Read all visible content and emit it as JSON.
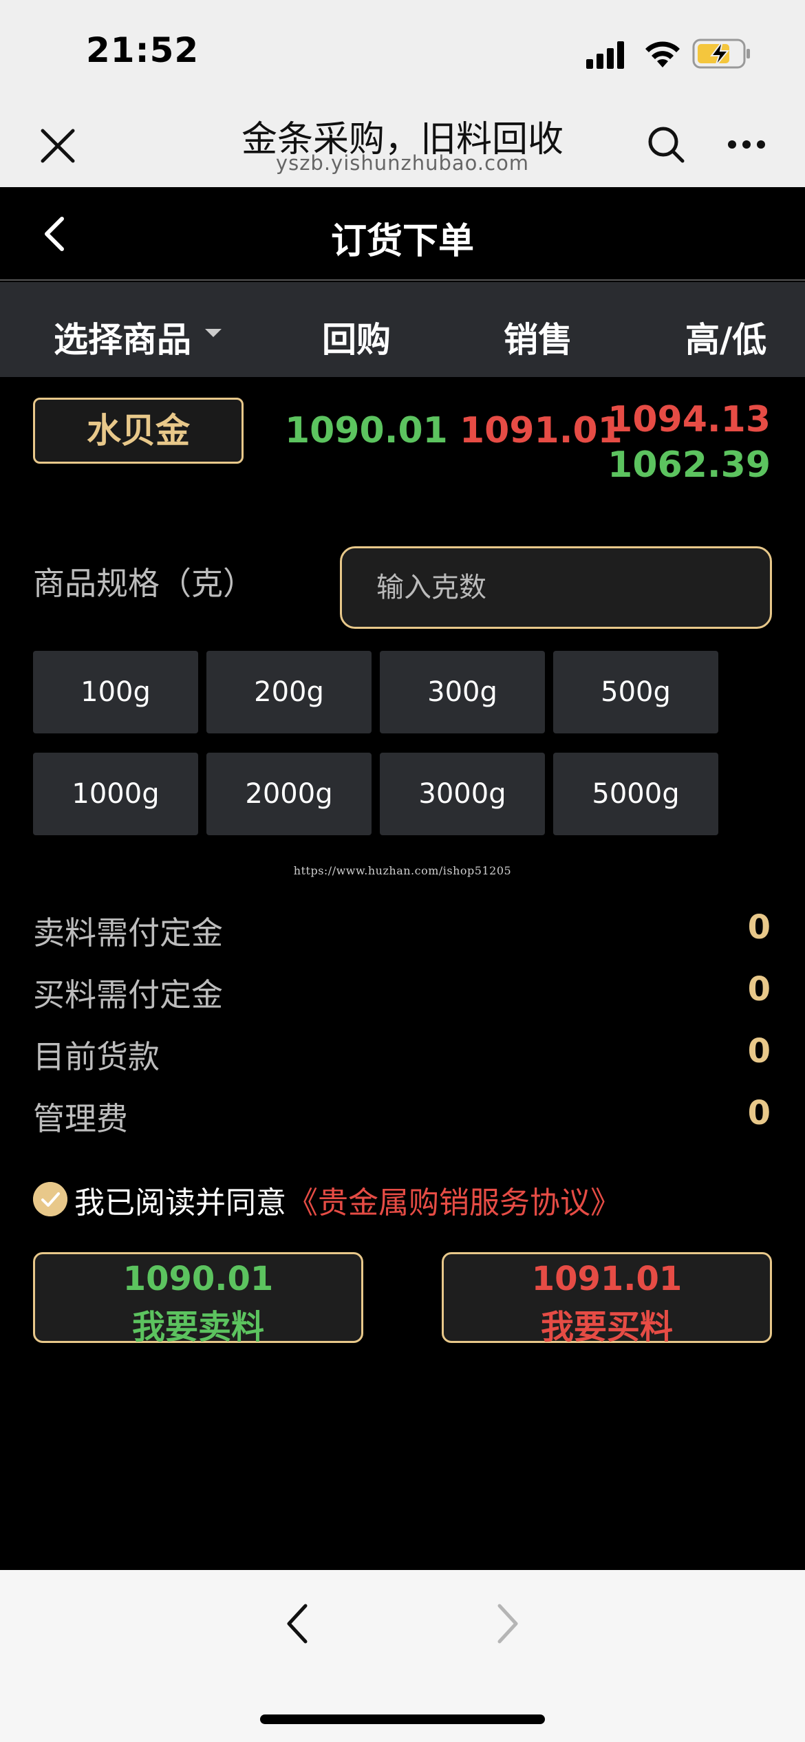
{
  "status": {
    "time": "21:52"
  },
  "browser": {
    "title": "金条采购，旧料回收",
    "url": "yszb.yishunzhubao.com"
  },
  "page": {
    "title": "订货下单"
  },
  "table_header": {
    "select": "选择商品",
    "buyback": "回购",
    "sale": "销售",
    "high_low": "高/低"
  },
  "product": {
    "name": "水贝金",
    "buyback_price": "1090.01",
    "sale_price": "1091.01",
    "high": "1094.13",
    "low": "1062.39"
  },
  "spec": {
    "label": "商品规格（克）",
    "placeholder": "输入克数",
    "value": "",
    "options": [
      "100g",
      "200g",
      "300g",
      "500g",
      "1000g",
      "2000g",
      "3000g",
      "5000g"
    ]
  },
  "watermark": "https://www.huzhan.com/ishop51205",
  "fees": [
    {
      "label": "卖料需付定金",
      "value": "0"
    },
    {
      "label": "买料需付定金",
      "value": "0"
    },
    {
      "label": "目前货款",
      "value": "0"
    },
    {
      "label": "管理费",
      "value": "0"
    }
  ],
  "agreement": {
    "prefix": "我已阅读并同意",
    "link": "《贵金属购销服务协议》",
    "checked": true
  },
  "actions": {
    "sell": {
      "price": "1090.01",
      "label": "我要卖料"
    },
    "buy": {
      "price": "1091.01",
      "label": "我要买料"
    }
  },
  "colors": {
    "accent_gold": "#e8c88a",
    "price_up_green": "#5cc35f",
    "price_down_red": "#e64c45",
    "header_gray": "#2a2c30"
  }
}
